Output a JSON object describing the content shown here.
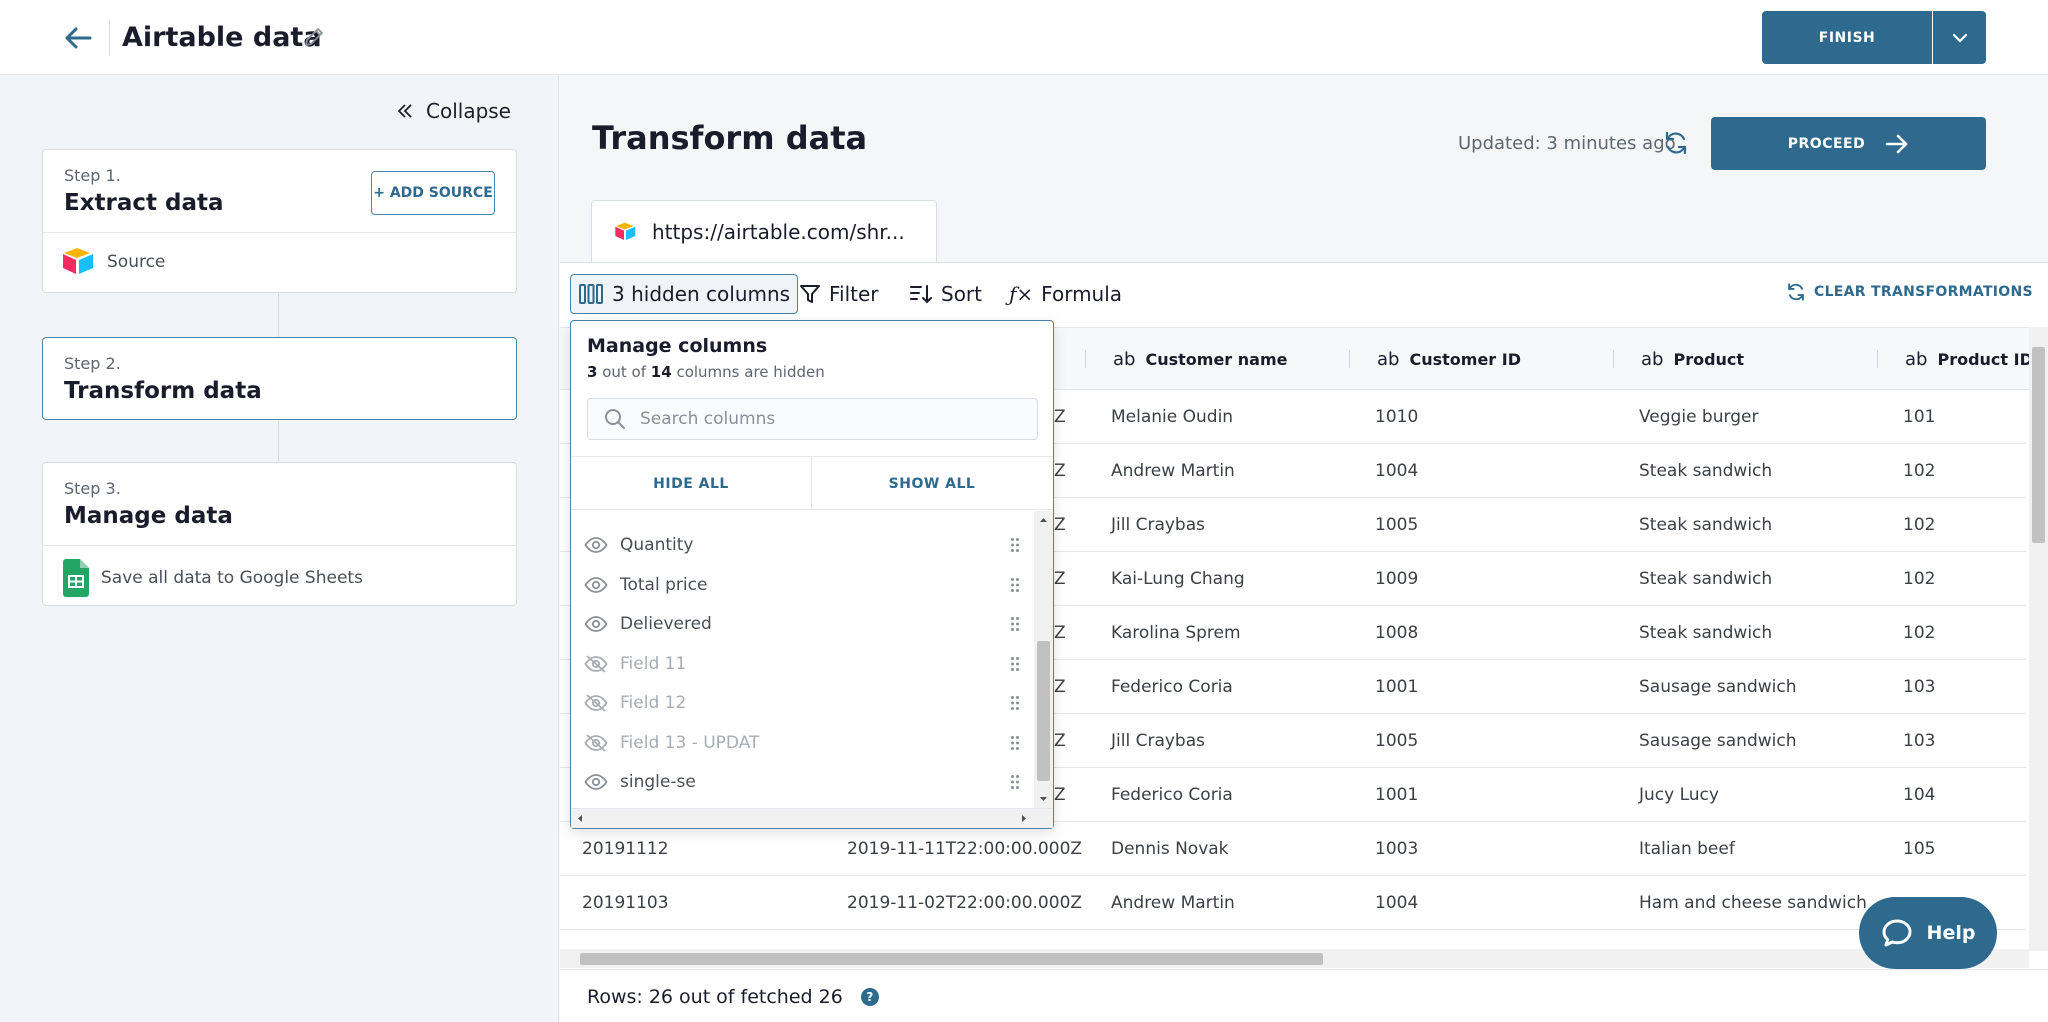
{
  "header": {
    "title": "Airtable data",
    "finish_label": "FINISH"
  },
  "sidebar": {
    "collapse_label": "Collapse",
    "steps": [
      {
        "label": "Step 1.",
        "title": "Extract data",
        "add_source_label": "+ ADD SOURCE",
        "sub": "Source"
      },
      {
        "label": "Step 2.",
        "title": "Transform data"
      },
      {
        "label": "Step 3.",
        "title": "Manage data",
        "sub": "Save all data to Google Sheets"
      }
    ]
  },
  "main": {
    "title": "Transform data",
    "updated": "Updated: 3 minutes ago",
    "proceed_label": "PROCEED",
    "tab_label": "https://airtable.com/shr..."
  },
  "toolbar": {
    "hidden_columns": "3 hidden columns",
    "filter": "Filter",
    "sort": "Sort",
    "formula": "Formula",
    "clear": "CLEAR TRANSFORMATIONS"
  },
  "table": {
    "columns": [
      "Customer name",
      "Customer ID",
      "Product",
      "Product ID"
    ],
    "type_glyph": "ab",
    "rows": [
      {
        "c1": "",
        "c2": "Z",
        "name": "Melanie Oudin",
        "cid": "1010",
        "product": "Veggie burger",
        "pid": "101"
      },
      {
        "c1": "",
        "c2": "Z",
        "name": "Andrew Martin",
        "cid": "1004",
        "product": "Steak sandwich",
        "pid": "102"
      },
      {
        "c1": "",
        "c2": "Z",
        "name": "Jill Craybas",
        "cid": "1005",
        "product": "Steak sandwich",
        "pid": "102"
      },
      {
        "c1": "",
        "c2": "Z",
        "name": "Kai-Lung Chang",
        "cid": "1009",
        "product": "Steak sandwich",
        "pid": "102"
      },
      {
        "c1": "",
        "c2": "Z",
        "name": "Karolina Sprem",
        "cid": "1008",
        "product": "Steak sandwich",
        "pid": "102"
      },
      {
        "c1": "",
        "c2": "Z",
        "name": "Federico Coria",
        "cid": "1001",
        "product": "Sausage sandwich",
        "pid": "103"
      },
      {
        "c1": "",
        "c2": "Z",
        "name": "Jill Craybas",
        "cid": "1005",
        "product": "Sausage sandwich",
        "pid": "103"
      },
      {
        "c1": "",
        "c2": "Z",
        "name": "Federico Coria",
        "cid": "1001",
        "product": "Jucy Lucy",
        "pid": "104"
      },
      {
        "c1": "20191112",
        "c2": "2019-11-11T22:00:00.000Z",
        "name": "Dennis Novak",
        "cid": "1003",
        "product": "Italian beef",
        "pid": "105"
      },
      {
        "c1": "20191103",
        "c2": "2019-11-02T22:00:00.000Z",
        "name": "Andrew Martin",
        "cid": "1004",
        "product": "Ham and cheese sandwich",
        "pid": ""
      }
    ]
  },
  "footer": {
    "rows_label": "Rows:",
    "rows_value": "26 out of fetched 26",
    "help_q": "?"
  },
  "help_label": "Help",
  "manage_columns": {
    "title": "Manage columns",
    "hidden_count": "3",
    "out_of": "out of",
    "total_count": "14",
    "suffix": "columns are hidden",
    "search_placeholder": "Search columns",
    "hide_all": "HIDE ALL",
    "show_all": "SHOW ALL",
    "items": [
      {
        "label": "Quantity",
        "visible": true
      },
      {
        "label": "Total price",
        "visible": true
      },
      {
        "label": "Delievered",
        "visible": true
      },
      {
        "label": "Field 11",
        "visible": false
      },
      {
        "label": "Field 12",
        "visible": false
      },
      {
        "label": "Field 13 - UPDAT",
        "visible": false
      },
      {
        "label": "single-se",
        "visible": true
      }
    ]
  },
  "colors": {
    "accent": "#2e6a8e",
    "accent_border": "#4a85a8"
  }
}
